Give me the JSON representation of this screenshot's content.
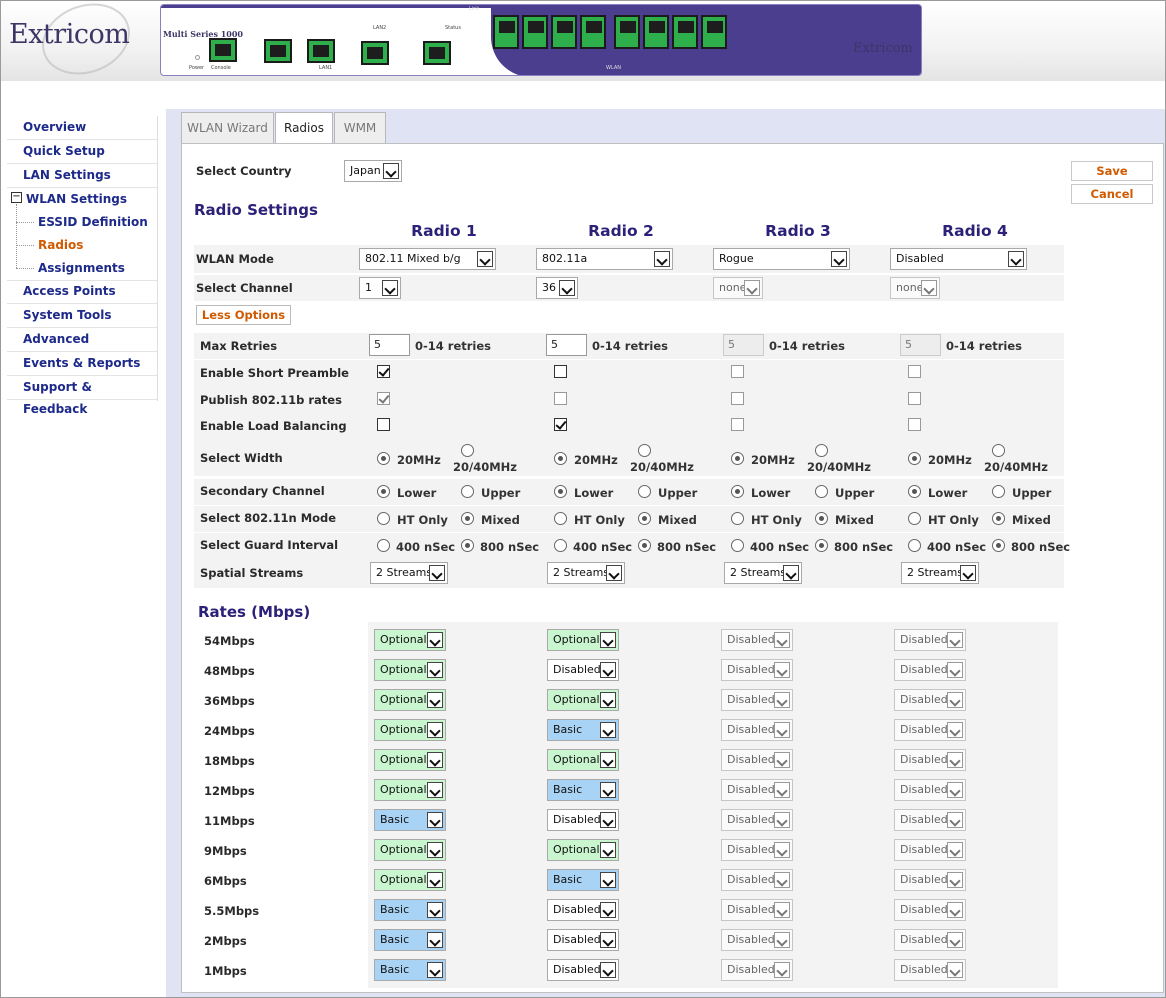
{
  "brand": {
    "name": "Extricom",
    "device_name": "Multi Series 1000",
    "device_logo": "Extricom"
  },
  "device_labels": {
    "power": "Power",
    "console": "Console",
    "lan1": "LAN1",
    "lan2": "LAN2",
    "status": "Status",
    "link": "Link",
    "wlan": "WLAN"
  },
  "sidebar": {
    "items": [
      {
        "label": "Overview"
      },
      {
        "label": "Quick Setup"
      },
      {
        "label": "LAN Settings"
      },
      {
        "label": "WLAN Settings"
      },
      {
        "label": "ESSID Definition"
      },
      {
        "label": "Radios"
      },
      {
        "label": "Assignments"
      },
      {
        "label": "Access Points"
      },
      {
        "label": "System Tools"
      },
      {
        "label": "Advanced"
      },
      {
        "label": "Events & Reports"
      },
      {
        "label": "Support & Feedback"
      }
    ],
    "tree_toggle": "−"
  },
  "tabs": [
    {
      "label": "WLAN Wizard"
    },
    {
      "label": "Radios"
    },
    {
      "label": "WMM"
    }
  ],
  "country": {
    "label": "Select Country",
    "value": "Japan"
  },
  "buttons": {
    "save": "Save",
    "cancel": "Cancel",
    "less_options": "Less Options"
  },
  "radio_settings": {
    "title": "Radio Settings",
    "radios": [
      "Radio 1",
      "Radio 2",
      "Radio 3",
      "Radio 4"
    ],
    "labels": {
      "wlan_mode": "WLAN Mode",
      "channel": "Select Channel",
      "max_retries": "Max Retries",
      "short_preamble": "Enable Short Preamble",
      "publish_rates": "Publish 802.11b rates",
      "load_balancing": "Enable Load Balancing",
      "width": "Select Width",
      "secondary": "Secondary Channel",
      "n_mode": "Select 802.11n Mode",
      "guard": "Select Guard Interval",
      "streams": "Spatial Streams"
    },
    "wlan_mode": [
      "802.11 Mixed b/g",
      "802.11a",
      "Rogue",
      "Disabled"
    ],
    "channel": [
      "1",
      "36",
      "none",
      "none"
    ],
    "max_retries": [
      "5",
      "5",
      "5",
      "5"
    ],
    "retries_hint": "0-14 retries",
    "short_preamble": [
      true,
      false,
      false,
      false
    ],
    "publish_rates": [
      true,
      false,
      false,
      false
    ],
    "load_balancing": [
      false,
      true,
      false,
      false
    ],
    "options": {
      "w20": "20MHz",
      "w2040": "20/40MHz",
      "lower": "Lower",
      "upper": "Upper",
      "ht_only": "HT Only",
      "mixed": "Mixed",
      "g400": "400 nSec",
      "g800": "800 nSec"
    },
    "streams": [
      "2 Streams",
      "2 Streams",
      "2 Streams",
      "2 Streams"
    ]
  },
  "rates": {
    "title": "Rates (Mbps)",
    "rows": [
      {
        "label": "54Mbps",
        "values": [
          "Optional",
          "Optional",
          "Disabled",
          "Disabled"
        ]
      },
      {
        "label": "48Mbps",
        "values": [
          "Optional",
          "Disabled",
          "Disabled",
          "Disabled"
        ]
      },
      {
        "label": "36Mbps",
        "values": [
          "Optional",
          "Optional",
          "Disabled",
          "Disabled"
        ]
      },
      {
        "label": "24Mbps",
        "values": [
          "Optional",
          "Basic",
          "Disabled",
          "Disabled"
        ]
      },
      {
        "label": "18Mbps",
        "values": [
          "Optional",
          "Optional",
          "Disabled",
          "Disabled"
        ]
      },
      {
        "label": "12Mbps",
        "values": [
          "Optional",
          "Basic",
          "Disabled",
          "Disabled"
        ]
      },
      {
        "label": "11Mbps",
        "values": [
          "Basic",
          "Disabled",
          "Disabled",
          "Disabled"
        ]
      },
      {
        "label": "9Mbps",
        "values": [
          "Optional",
          "Optional",
          "Disabled",
          "Disabled"
        ]
      },
      {
        "label": "6Mbps",
        "values": [
          "Optional",
          "Basic",
          "Disabled",
          "Disabled"
        ]
      },
      {
        "label": "5.5Mbps",
        "values": [
          "Basic",
          "Disabled",
          "Disabled",
          "Disabled"
        ]
      },
      {
        "label": "2Mbps",
        "values": [
          "Basic",
          "Disabled",
          "Disabled",
          "Disabled"
        ]
      },
      {
        "label": "1Mbps",
        "values": [
          "Basic",
          "Disabled",
          "Disabled",
          "Disabled"
        ]
      }
    ]
  },
  "colors": {
    "accent": "#2b2178",
    "nav": "#1e2a8a",
    "active": "#d05a00",
    "optional": "#c9f5cf",
    "basic": "#a9d3f5"
  }
}
